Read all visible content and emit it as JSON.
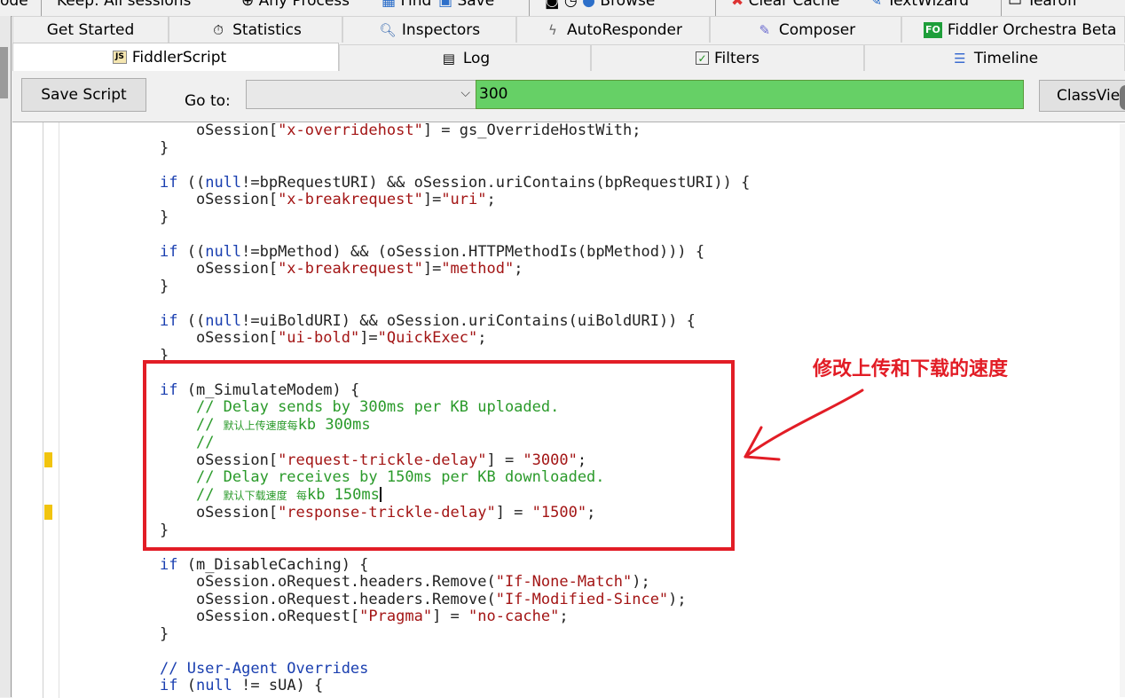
{
  "toolbar": {
    "items": [
      "ode",
      "Keep: All sessions",
      "Any Process",
      "Find",
      "Save",
      "Browse",
      "Clear Cache",
      "TextWizard",
      "Tearoff"
    ]
  },
  "tabs_row1": [
    {
      "label": "Get Started",
      "icon": ""
    },
    {
      "label": "Statistics",
      "icon": "stopwatch-icon"
    },
    {
      "label": "Inspectors",
      "icon": "magnifier-icon"
    },
    {
      "label": "AutoResponder",
      "icon": "lightning-icon"
    },
    {
      "label": "Composer",
      "icon": "pencil-icon"
    },
    {
      "label": "Fiddler Orchestra Beta",
      "icon": "fo-icon",
      "badge": "FO"
    }
  ],
  "tabs_row2": [
    {
      "label": "FiddlerScript",
      "icon": "js-script-icon",
      "badge": "JS",
      "active": true
    },
    {
      "label": "Log",
      "icon": "log-icon"
    },
    {
      "label": "Filters",
      "icon": "checkbox-icon"
    },
    {
      "label": "Timeline",
      "icon": "timeline-icon"
    }
  ],
  "script_toolbar": {
    "save_label": "Save Script",
    "goto_label": "Go to:",
    "goto_value": "",
    "search_value": "300",
    "classview_label": "ClassView"
  },
  "annotation": {
    "text": "修改上传和下载的速度",
    "color": "#e21d26"
  },
  "colors": {
    "keyword": "#1a3fb0",
    "string": "#a31515",
    "comment": "#2a9a2a",
    "search_bg": "#66d066",
    "marker": "#f1c40f"
  },
  "code_lines": [
    "    oSession[\"x-overridehost\"] = gs_OverrideHostWith;",
    "}",
    "",
    "if ((null!=bpRequestURI) && oSession.uriContains(bpRequestURI)) {",
    "    oSession[\"x-breakrequest\"]=\"uri\";",
    "}",
    "",
    "if ((null!=bpMethod) && (oSession.HTTPMethodIs(bpMethod))) {",
    "    oSession[\"x-breakrequest\"]=\"method\";",
    "}",
    "",
    "if ((null!=uiBoldURI) && oSession.uriContains(uiBoldURI)) {",
    "    oSession[\"ui-bold\"]=\"QuickExec\";",
    "}",
    "",
    "if (m_SimulateModem) {",
    "    // Delay sends by 300ms per KB uploaded.",
    "    // 默认上传速度每kb 300ms",
    "    //",
    "    oSession[\"request-trickle-delay\"] = \"3000\";",
    "    // Delay receives by 150ms per KB downloaded.",
    "    // 默认下载速度 每kb 150ms",
    "    oSession[\"response-trickle-delay\"] = \"1500\";",
    "}",
    "",
    "if (m_DisableCaching) {",
    "    oSession.oRequest.headers.Remove(\"If-None-Match\");",
    "    oSession.oRequest.headers.Remove(\"If-Modified-Since\");",
    "    oSession.oRequest[\"Pragma\"] = \"no-cache\";",
    "}",
    "",
    "// User-Agent Overrides",
    "if (null != sUA) {"
  ]
}
